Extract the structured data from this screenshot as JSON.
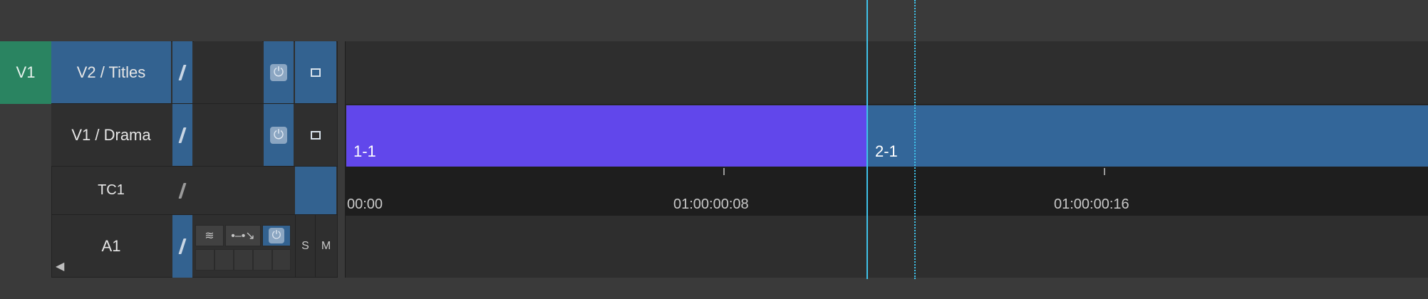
{
  "timeline": {
    "patch_label": "V1",
    "tracks": [
      {
        "name": "V2 / Titles"
      },
      {
        "name": "V1 / Drama"
      },
      {
        "name": "TC1"
      },
      {
        "name": "A1"
      }
    ],
    "clips": [
      {
        "label": "1-1",
        "color": "#6147eb"
      },
      {
        "label": "2-1",
        "color": "#336699"
      }
    ],
    "ruler": {
      "timecodes": [
        "00:00",
        "01:00:00:08",
        "01:00:00:16"
      ]
    },
    "audio_buttons": {
      "solo": "S",
      "mute": "M"
    },
    "colors": {
      "track_active": "#336290",
      "patch": "#2a8461",
      "playhead": "#3fc2ea"
    }
  }
}
